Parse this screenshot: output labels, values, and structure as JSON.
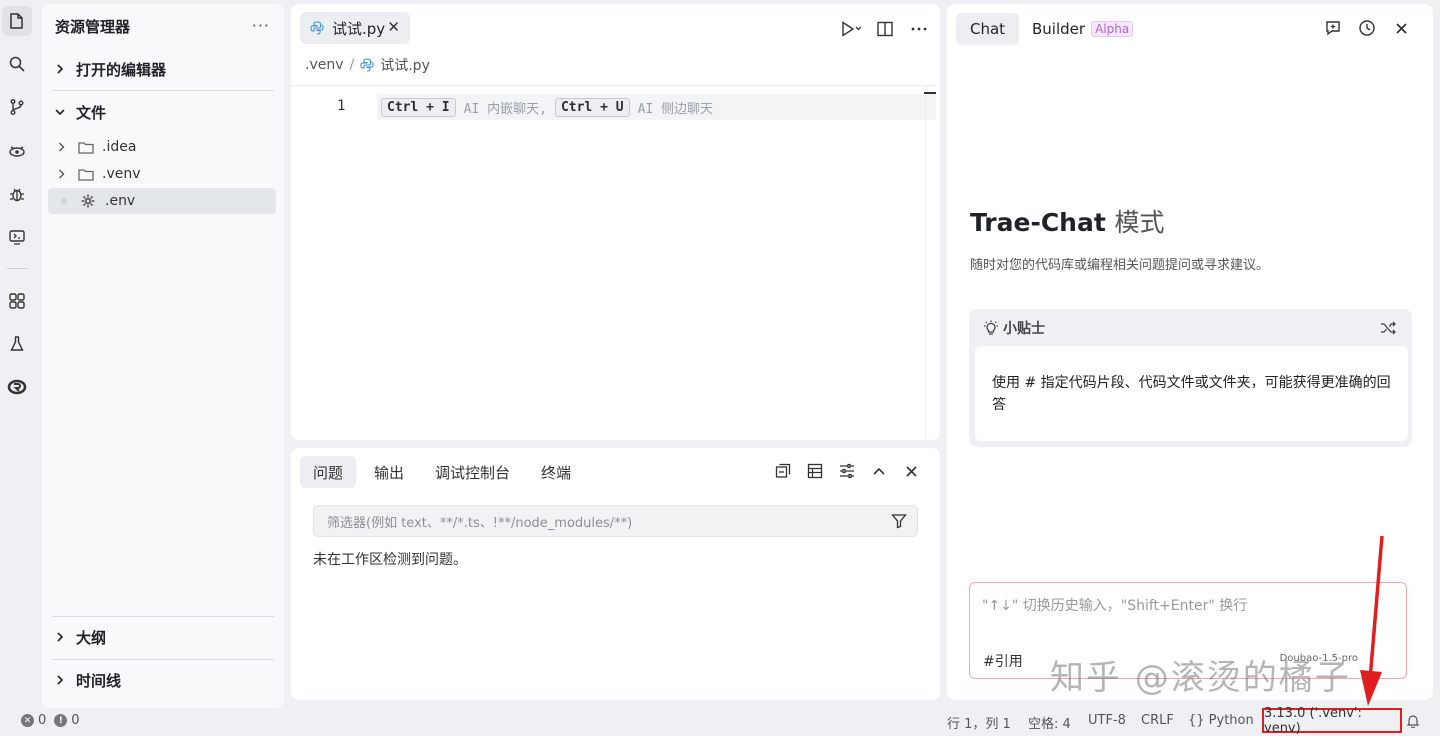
{
  "sidebar": {
    "title": "资源管理器",
    "more": "···",
    "sections": {
      "open_editors": "打开的编辑器",
      "files": "文件",
      "outline": "大纲",
      "timeline": "时间线"
    },
    "tree": [
      {
        "name": ".idea"
      },
      {
        "name": ".venv"
      },
      {
        "name": ".env"
      }
    ]
  },
  "editor": {
    "tab_label": "试试.py",
    "breadcrumb": [
      ".venv",
      "试试.py"
    ],
    "line_number": "1",
    "hint": {
      "key1": "Ctrl + I",
      "text1": "AI 内嵌聊天,",
      "key2": "Ctrl + U",
      "text2": "AI 侧边聊天"
    }
  },
  "panel": {
    "tabs": [
      "问题",
      "输出",
      "调试控制台",
      "终端"
    ],
    "filter_placeholder": "筛选器(例如 text、**/*.ts、!**/node_modules/**)",
    "empty_message": "未在工作区检测到问题。"
  },
  "chat": {
    "tabs": {
      "chat": "Chat",
      "builder": "Builder",
      "alpha": "Alpha"
    },
    "title_main": "Trae-Chat",
    "title_mode": "模式",
    "subtitle": "随时对您的代码库或编程相关问题提问或寻求建议。",
    "tip_title": "小贴士",
    "tip_body": "使用 # 指定代码片段、代码文件或文件夹，可能获得更准确的回答",
    "input_placeholder": "\"↑↓\" 切换历史输入，\"Shift+Enter\" 换行",
    "cite": "#引用",
    "model": "Doubao-1.5-pro"
  },
  "watermark": "知乎 @滚烫的橘子",
  "status": {
    "errors": "0",
    "warnings": "0",
    "position": "行 1，列 1",
    "spaces": "空格: 4",
    "encoding": "UTF-8",
    "eol": "CRLF",
    "language": "{} Python",
    "interpreter": "3.13.0 ('.venv': venv)"
  },
  "colors": {
    "accent_red": "#e11e1e",
    "python_icon": "#3b8fd6",
    "alpha_badge": "#b264d9"
  }
}
